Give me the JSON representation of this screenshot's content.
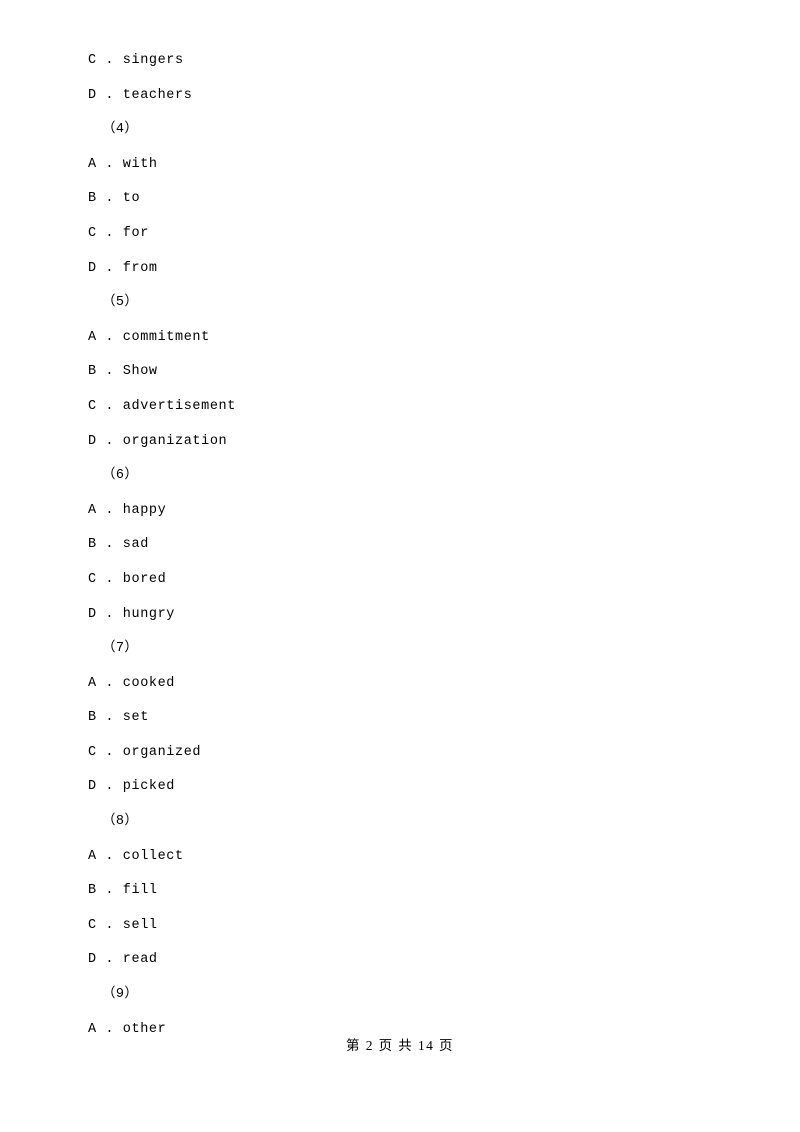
{
  "document": {
    "lines": [
      {
        "type": "option",
        "text": "C . singers"
      },
      {
        "type": "option",
        "text": "D . teachers"
      },
      {
        "type": "group",
        "text": "（4）"
      },
      {
        "type": "option",
        "text": "A . with"
      },
      {
        "type": "option",
        "text": "B . to"
      },
      {
        "type": "option",
        "text": "C . for"
      },
      {
        "type": "option",
        "text": "D . from"
      },
      {
        "type": "group",
        "text": "（5）"
      },
      {
        "type": "option",
        "text": "A . commitment"
      },
      {
        "type": "option",
        "text": "B . Show"
      },
      {
        "type": "option",
        "text": "C . advertisement"
      },
      {
        "type": "option",
        "text": "D . organization"
      },
      {
        "type": "group",
        "text": "（6）"
      },
      {
        "type": "option",
        "text": "A . happy"
      },
      {
        "type": "option",
        "text": "B . sad"
      },
      {
        "type": "option",
        "text": "C . bored"
      },
      {
        "type": "option",
        "text": "D . hungry"
      },
      {
        "type": "group",
        "text": "（7）"
      },
      {
        "type": "option",
        "text": "A . cooked"
      },
      {
        "type": "option",
        "text": "B . set"
      },
      {
        "type": "option",
        "text": "C . organized"
      },
      {
        "type": "option",
        "text": "D . picked"
      },
      {
        "type": "group",
        "text": "（8）"
      },
      {
        "type": "option",
        "text": "A . collect"
      },
      {
        "type": "option",
        "text": "B . fill"
      },
      {
        "type": "option",
        "text": "C . sell"
      },
      {
        "type": "option",
        "text": "D . read"
      },
      {
        "type": "group",
        "text": "（9）"
      },
      {
        "type": "option",
        "text": "A . other"
      }
    ],
    "footer": "第 2 页 共 14 页"
  }
}
